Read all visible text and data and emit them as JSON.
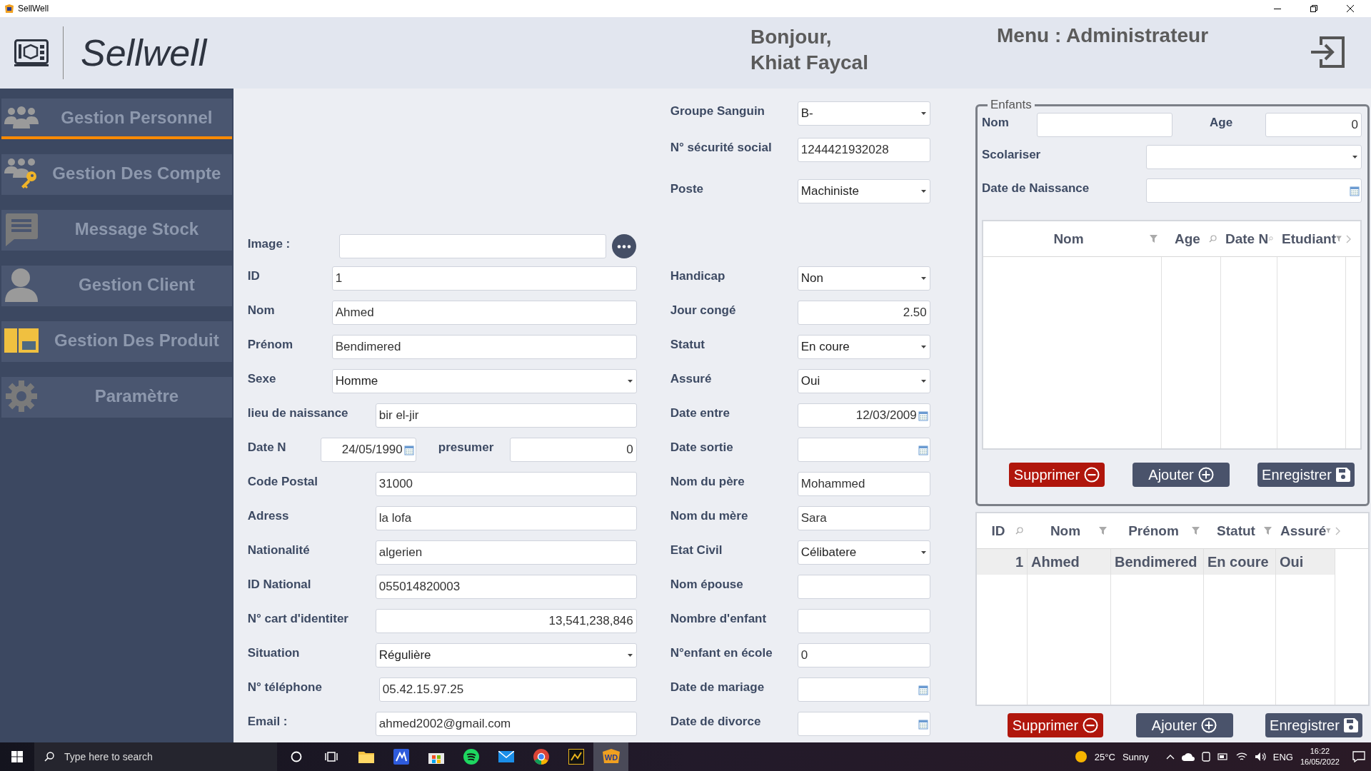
{
  "window": {
    "title": "SellWell"
  },
  "header": {
    "brand": "Sellwell",
    "greeting": "Bonjour,",
    "user": "Khiat Faycal",
    "menu": "Menu : Administrateur"
  },
  "sidebar": {
    "items": [
      {
        "label": "Gestion Personnel",
        "kind": "people",
        "selected": true
      },
      {
        "label": "Gestion Des Compte",
        "kind": "accounts",
        "selected": false
      },
      {
        "label": "Message Stock",
        "kind": "message",
        "selected": false
      },
      {
        "label": "Gestion Client",
        "kind": "client",
        "selected": false
      },
      {
        "label": "Gestion Des Produit",
        "kind": "products",
        "selected": false
      },
      {
        "label": "Paramètre",
        "kind": "settings",
        "selected": false
      }
    ]
  },
  "form": {
    "image": {
      "label": "Image :"
    },
    "left_fields": [
      {
        "label": "ID",
        "kind": "text",
        "value": "1"
      },
      {
        "label": "Nom",
        "kind": "text",
        "value": "Ahmed"
      },
      {
        "label": "Prénom",
        "kind": "text",
        "value": "Bendimered"
      },
      {
        "label": "Sexe",
        "kind": "select",
        "value": "Homme"
      },
      {
        "label": "lieu de naissance",
        "kind": "text",
        "value": "bir el-jir"
      },
      {
        "label": "Date N",
        "kind": "date_pair",
        "value": "24/05/1990",
        "second_label": "presumer",
        "second_value": "0"
      },
      {
        "label": "Code Postal",
        "kind": "text",
        "value": "31000"
      },
      {
        "label": "Adress",
        "kind": "text",
        "value": "la lofa"
      },
      {
        "label": "Nationalité",
        "kind": "text",
        "value": "algerien"
      },
      {
        "label": "ID National",
        "kind": "text",
        "value": "055014820003"
      },
      {
        "label": "N° cart d'identiter",
        "kind": "number",
        "value": "13,541,238,846"
      },
      {
        "label": "Situation",
        "kind": "select",
        "value": "Régulière"
      },
      {
        "label": "N° téléphone",
        "kind": "text",
        "value": "05.42.15.97.25"
      },
      {
        "label": "Email :",
        "kind": "text",
        "value": "ahmed2002@gmail.com"
      }
    ],
    "top_right_fields": [
      {
        "label": "Groupe Sanguin",
        "kind": "select",
        "value": "B-"
      },
      {
        "label": "N° sécurité social",
        "kind": "text",
        "value": "1244421932028"
      },
      {
        "label": "Poste",
        "kind": "select",
        "value": "Machiniste"
      }
    ],
    "right_fields": [
      {
        "label": "Handicap",
        "kind": "select",
        "value": "Non"
      },
      {
        "label": "Jour congé",
        "kind": "number",
        "value": "2.50"
      },
      {
        "label": "Statut",
        "kind": "select",
        "value": "En coure"
      },
      {
        "label": "Assuré",
        "kind": "select",
        "value": "Oui"
      },
      {
        "label": "Date entre",
        "kind": "date",
        "value": "12/03/2009"
      },
      {
        "label": "Date sortie",
        "kind": "date"
      },
      {
        "label": "Nom du père",
        "kind": "text",
        "value": "Mohammed"
      },
      {
        "label": "Nom du mère",
        "kind": "text",
        "value": "Sara"
      },
      {
        "label": "Etat Civil",
        "kind": "select",
        "value": "Célibatere"
      },
      {
        "label": "Nom épouse",
        "kind": "text"
      },
      {
        "label": "Nombre d'enfant",
        "kind": "text"
      },
      {
        "label": "N°enfant en école",
        "kind": "text",
        "value": "0"
      },
      {
        "label": "Date de mariage",
        "kind": "date"
      },
      {
        "label": "Date de divorce",
        "kind": "date"
      }
    ]
  },
  "children": {
    "legend": "Enfants",
    "fields": [
      {
        "label": "Nom",
        "kind": "text"
      },
      {
        "label": "Age",
        "kind": "number",
        "value": "0"
      },
      {
        "label": "Scolariser",
        "kind": "select"
      },
      {
        "label": "Date de Naissance",
        "kind": "date"
      }
    ],
    "table": {
      "columns": [
        {
          "label": "Nom",
          "kind": "funnel"
        },
        {
          "label": "Age",
          "kind": "search"
        },
        {
          "label": "Date N",
          "kind": "search"
        },
        {
          "label": "Etudiant",
          "kind": "funnel"
        }
      ]
    },
    "buttons": [
      {
        "label": "Supprimer",
        "kind": "delete"
      },
      {
        "label": "Ajouter",
        "kind": "add"
      },
      {
        "label": "Enregistrer",
        "kind": "save"
      }
    ]
  },
  "employees": {
    "table": {
      "columns": [
        {
          "label": "ID",
          "kind": "search"
        },
        {
          "label": "Nom",
          "kind": "funnel"
        },
        {
          "label": "Prénom",
          "kind": "funnel"
        },
        {
          "label": "Statut",
          "kind": "funnel"
        },
        {
          "label": "Assuré",
          "kind": "funnel"
        }
      ],
      "rows": [
        {
          "cells": [
            "1",
            "Ahmed",
            "Bendimered",
            "En coure",
            "Oui"
          ],
          "selected": true
        }
      ]
    },
    "buttons": [
      {
        "label": "Supprimer",
        "kind": "delete"
      },
      {
        "label": "Ajouter",
        "kind": "add"
      },
      {
        "label": "Enregistrer",
        "kind": "save"
      }
    ]
  },
  "taskbar": {
    "search_placeholder": "Type here to search",
    "apps": [
      {
        "kind": "cortana",
        "selected": false
      },
      {
        "kind": "taskview",
        "selected": false
      },
      {
        "kind": "folder",
        "selected": false
      },
      {
        "kind": "editor",
        "selected": false
      },
      {
        "kind": "store",
        "selected": false
      },
      {
        "kind": "music",
        "selected": false
      },
      {
        "kind": "mail",
        "selected": false
      },
      {
        "kind": "browser",
        "selected": false
      },
      {
        "kind": "chart",
        "selected": false
      },
      {
        "kind": "wd",
        "label": "WD",
        "selected": true
      }
    ],
    "weather": {
      "temp": "25°C",
      "text": "Sunny"
    },
    "language": "ENG",
    "time": "16:22",
    "date": "16/05/2022"
  }
}
